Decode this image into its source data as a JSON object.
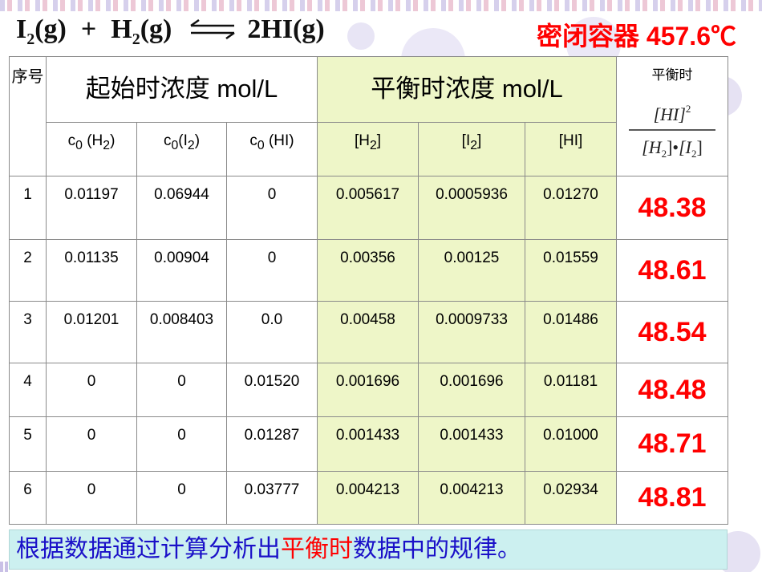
{
  "equation": {
    "reactant1": "I",
    "reactant1_sub": "2",
    "reactant1_state": "(g)",
    "plus": "+",
    "reactant2": "H",
    "reactant2_sub": "2",
    "reactant2_state": "(g)",
    "product": "2HI(g)"
  },
  "condition": "密闭容器 457.6℃",
  "table": {
    "seq_header": "序号",
    "initial_header": "起始时浓度 mol/L",
    "equilibrium_header": "平衡时浓度 mol/L",
    "k_header": "平衡时",
    "k_expression": {
      "numerator": "[HI]",
      "numerator_power": "2",
      "denominator_left": "[H",
      "denominator_left_sub": "2",
      "denominator_bullet": "]•",
      "denominator_right": "[I",
      "denominator_right_sub": "2",
      "denominator_close": "]"
    },
    "sub_headers": [
      "c",
      "c",
      "c",
      "[H",
      "[I",
      "[HI]"
    ],
    "sub_header_parts": {
      "c0_h2_a": "c",
      "c0_h2_sub": "0",
      "c0_h2_b": " (H",
      "c0_h2_sub2": "2",
      "c0_h2_c": ")",
      "c0_i2_a": "c",
      "c0_i2_sub": "0",
      "c0_i2_b": "(I",
      "c0_i2_sub2": "2",
      "c0_i2_c": ")",
      "c0_hi_a": "c",
      "c0_hi_sub": "0",
      "c0_hi_b": " (HI)",
      "h2_a": "[H",
      "h2_sub": "2",
      "h2_b": "]",
      "i2_a": "[I",
      "i2_sub": "2",
      "i2_b": "]",
      "hi": "[HI]"
    },
    "rows": [
      {
        "seq": "1",
        "c0_h2": "0.01197",
        "c0_i2": "0.06944",
        "c0_hi": "0",
        "h2": "0.005617",
        "i2": "0.0005936",
        "hi": "0.01270",
        "k": "48.38"
      },
      {
        "seq": "2",
        "c0_h2": "0.01135",
        "c0_i2": "0.00904",
        "c0_hi": "0",
        "h2": "0.00356",
        "i2": "0.00125",
        "hi": "0.01559",
        "k": "48.61"
      },
      {
        "seq": "3",
        "c0_h2": "0.01201",
        "c0_i2": "0.008403",
        "c0_hi": "0.0",
        "h2": "0.00458",
        "i2": "0.0009733",
        "hi": "0.01486",
        "k": "48.54"
      },
      {
        "seq": "4",
        "c0_h2": "0",
        "c0_i2": "0",
        "c0_hi": "0.01520",
        "h2": "0.001696",
        "i2": "0.001696",
        "hi": "0.01181",
        "k": "48.48"
      },
      {
        "seq": "5",
        "c0_h2": "0",
        "c0_i2": "0",
        "c0_hi": "0.01287",
        "h2": "0.001433",
        "i2": "0.001433",
        "hi": "0.01000",
        "k": "48.71"
      },
      {
        "seq": "6",
        "c0_h2": "0",
        "c0_i2": "0",
        "c0_hi": "0.03777",
        "h2": "0.004213",
        "i2": "0.004213",
        "hi": "0.02934",
        "k": "48.81"
      }
    ]
  },
  "footer": {
    "part1": "根据数据通过计算分析出",
    "part2_highlight": "平衡时",
    "part3": "数据中的规律。"
  },
  "colors": {
    "title_red": "#ff0000",
    "footer_blue": "#1a10c8",
    "footer_bg": "#ccf0f0",
    "equilibrium_bg": "#eef6c8",
    "decor_circle": "#d9d4ee"
  }
}
